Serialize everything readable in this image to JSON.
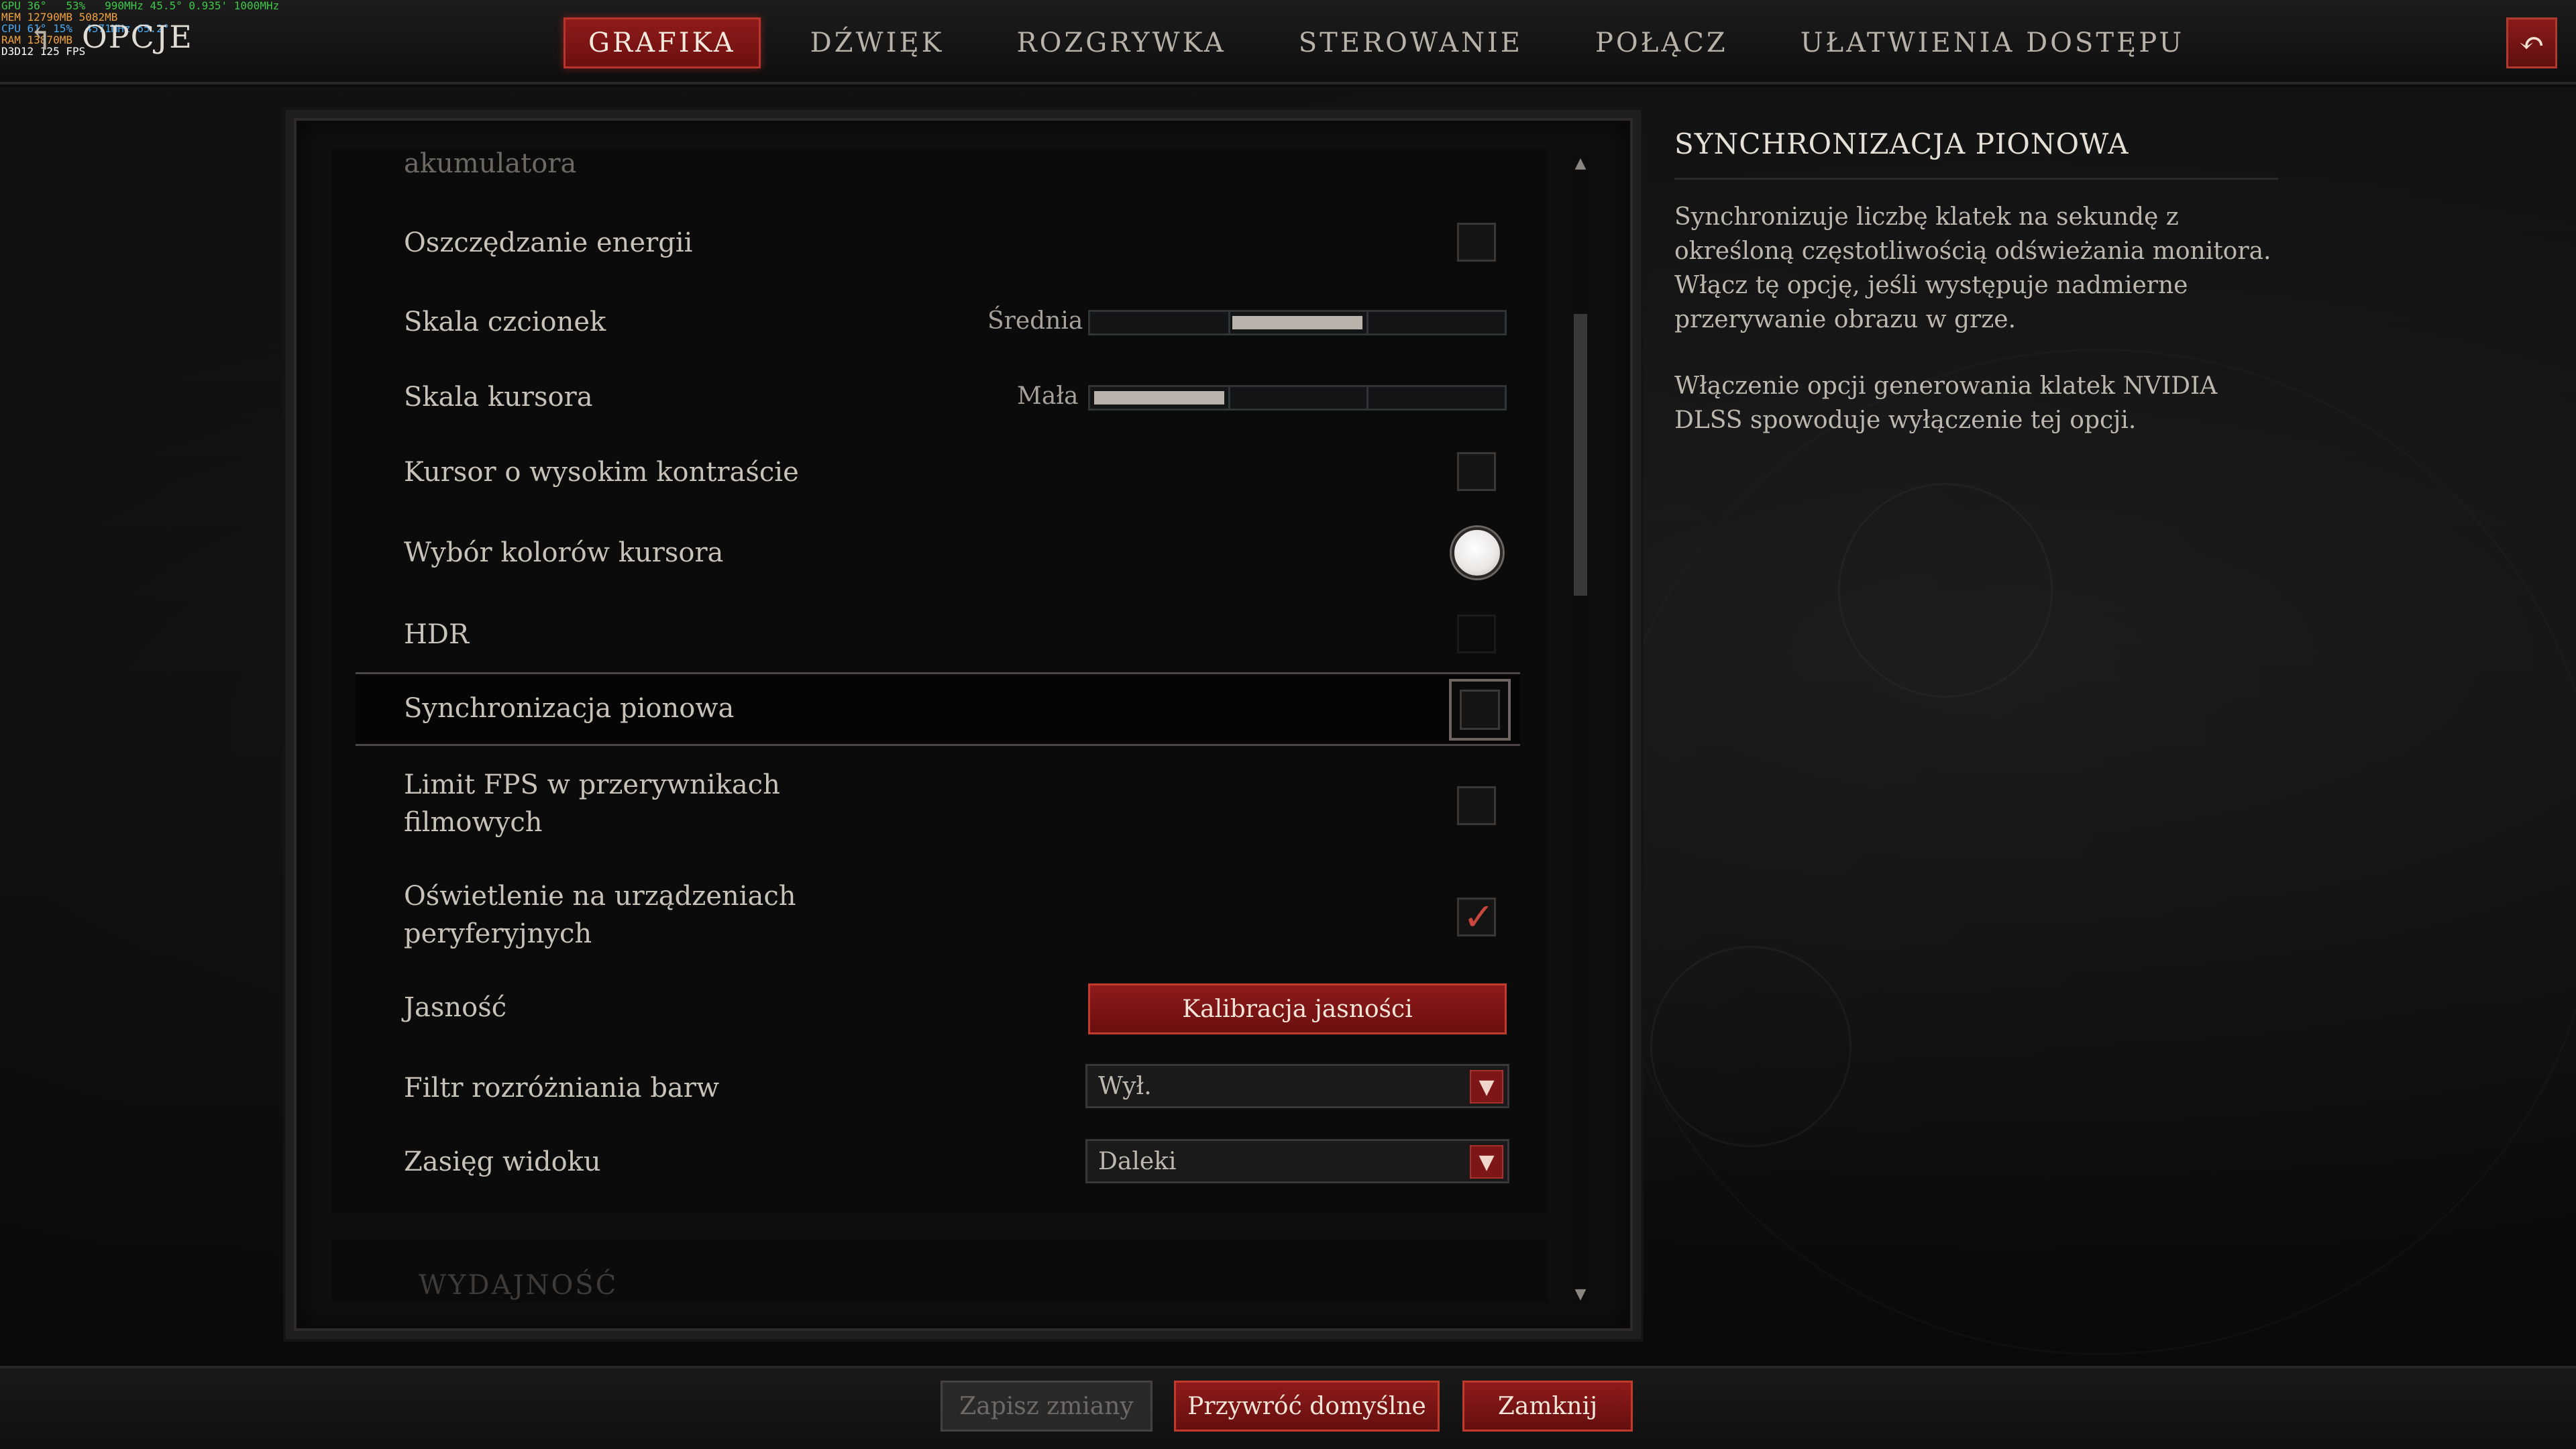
{
  "overlay": {
    "rows": [
      {
        "label": "GPU",
        "values": "36°   53%   990MHz 45.5° 0.935' 1000MHz",
        "color": "#3ec84a"
      },
      {
        "label": "MEM",
        "values": "12790MB 5082MB",
        "color": "#f0a23c"
      },
      {
        "label": "CPU",
        "values": "61° 15%  4571MHz 65.2°",
        "color": "#4aa8f0"
      },
      {
        "label": "RAM",
        "values": "13870MB",
        "color": "#f0a23c"
      },
      {
        "label": "D3D12",
        "values": "125 FPS",
        "color": "#ffffff"
      }
    ]
  },
  "header": {
    "title": "OPCJE",
    "tabs": [
      {
        "label": "GRAFIKA",
        "active": true
      },
      {
        "label": "DŹWIĘK",
        "active": false
      },
      {
        "label": "ROZGRYWKA",
        "active": false
      },
      {
        "label": "STEROWANIE",
        "active": false
      },
      {
        "label": "POŁĄCZ",
        "active": false
      },
      {
        "label": "UŁATWIENIA DOSTĘPU",
        "active": false
      }
    ],
    "back_icon": "back-arrow-icon"
  },
  "settings": {
    "cut_top_label": "akumulatora",
    "power_saving": {
      "label": "Oszczędzanie energii",
      "checked": false
    },
    "font_scale": {
      "label": "Skala czcionek",
      "value": "Średnia",
      "level": 2,
      "levels": 3
    },
    "cursor_scale": {
      "label": "Skala kursora",
      "value": "Mała",
      "level": 1,
      "levels": 3
    },
    "high_contrast_cursor": {
      "label": "Kursor o wysokim kontraście",
      "checked": false
    },
    "cursor_color": {
      "label": "Wybór kolorów kursora",
      "color": "#ffffff"
    },
    "hdr": {
      "label": "HDR",
      "checked": false,
      "disabled": true
    },
    "vsync": {
      "label": "Synchronizacja pionowa",
      "checked": false,
      "selected": true
    },
    "fps_limit": {
      "label_line1": "Limit FPS w przerywnikach",
      "label_line2": "filmowych",
      "checked": false
    },
    "peripheral_lighting": {
      "label_line1": "Oświetlenie na urządzeniach",
      "label_line2": "peryferyjnych",
      "checked": true
    },
    "brightness": {
      "label": "Jasność",
      "button": "Kalibracja jasności"
    },
    "color_filter": {
      "label": "Filtr rozróżniania barw",
      "value": "Wył."
    },
    "view_distance": {
      "label": "Zasięg widoku",
      "value": "Daleki"
    },
    "next_section": "WYDAJNOŚĆ"
  },
  "description": {
    "title": "SYNCHRONIZACJA PIONOWA",
    "paragraph1": "Synchronizuje liczbę klatek na sekundę z określoną częstotliwością odświeżania monitora. Włącz tę opcję, jeśli występuje nadmierne przerywanie obrazu w grze.",
    "paragraph2": "Włączenie opcji generowania klatek NVIDIA DLSS spowoduje wyłączenie tej opcji."
  },
  "footer": {
    "save": "Zapisz zmiany",
    "restore": "Przywróć domyślne",
    "close": "Zamknij"
  },
  "colors": {
    "accent_red": "#8f1a1a",
    "accent_border": "#c03a2e",
    "text_main": "#c8c2b8"
  }
}
